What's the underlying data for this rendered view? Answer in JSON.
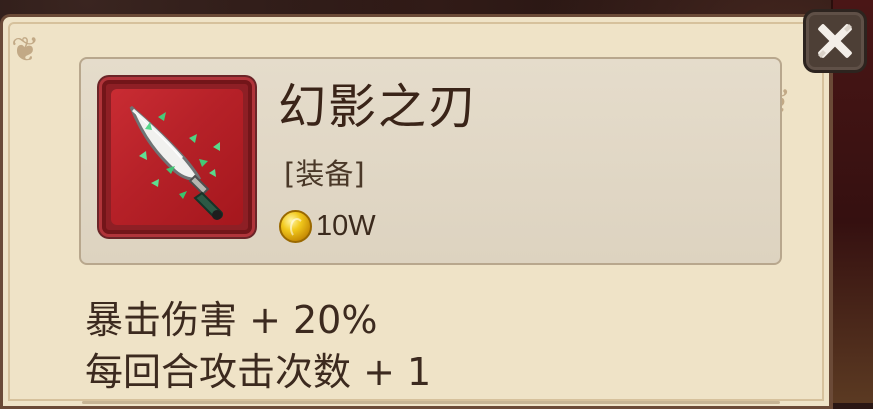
{
  "item": {
    "name": "幻影之刃",
    "type": "[装备]",
    "price": "10W",
    "icon": "phantom-blade-icon"
  },
  "stats": [
    "暴击伤害 + 20%",
    "每回合攻击次数 + 1"
  ],
  "ui": {
    "close_icon": "close-x-icon"
  }
}
